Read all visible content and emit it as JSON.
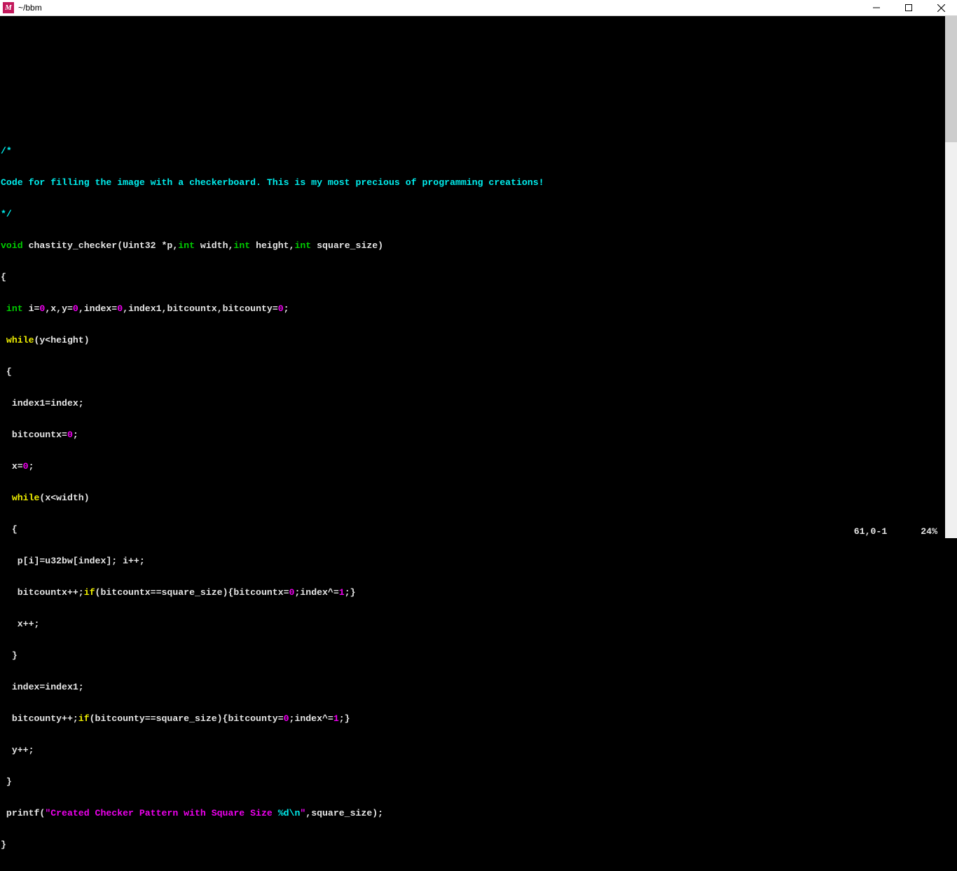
{
  "window": {
    "title": "~/bbm",
    "icon_letter": "M"
  },
  "code": {
    "comment_open": "/*",
    "comment_line": "Code for filling the image with a checkerboard. This is my most precious of programming creations!",
    "comment_close": "*/",
    "kw_void": "void",
    "func_sig_1": " chastity_checker(Uint32 *p,",
    "kw_int1": "int",
    "sig_width": " width,",
    "kw_int2": "int",
    "sig_height": " height,",
    "kw_int3": "int",
    "sig_sq": " square_size)",
    "brace_open": "{",
    "kw_int_decl": " int",
    "decl_1": " i=",
    "zero1": "0",
    "decl_2": ",x,y=",
    "zero2": "0",
    "decl_3": ",index=",
    "zero3": "0",
    "decl_4": ",index1,bitcountx,bitcounty=",
    "zero4": "0",
    "decl_end": ";",
    "kw_while1": " while",
    "while1_cond": "(y<height)",
    "brace_open2": " {",
    "l_index1": "  index1=index;",
    "l_bitcountx": "  bitcountx=",
    "zero5": "0",
    "l_bitcountx_end": ";",
    "l_x0": "  x=",
    "zero6": "0",
    "l_x0_end": ";",
    "kw_while2": "  while",
    "while2_cond": "(x<width)",
    "brace_open3": "  {",
    "l_pi": "   p[i]=u32bw[index]; i++;",
    "l_bcx_pre": "   bitcountx++;",
    "kw_if1": "if",
    "l_bcx_cond": "(bitcountx==square_size){bitcountx=",
    "zero7": "0",
    "l_bcx_mid": ";index^=",
    "one1": "1",
    "l_bcx_end": ";}",
    "l_xpp": "   x++;",
    "brace_close3": "  }",
    "l_index_restore": "  index=index1;",
    "l_bcy_pre": "  bitcounty++;",
    "kw_if2": "if",
    "l_bcy_cond": "(bitcounty==square_size){bitcounty=",
    "zero8": "0",
    "l_bcy_mid": ";index^=",
    "one2": "1",
    "l_bcy_end": ";}",
    "l_ypp": "  y++;",
    "brace_close2": " }",
    "l_printf_pre": " printf(",
    "str1": "\"Created Checker Pattern with Square Size ",
    "fmt": "%d\\n",
    "str2": "\"",
    "l_printf_post": ",square_size);",
    "brace_close": "}"
  },
  "status": {
    "position": "61,0-1",
    "percent": "24%"
  }
}
